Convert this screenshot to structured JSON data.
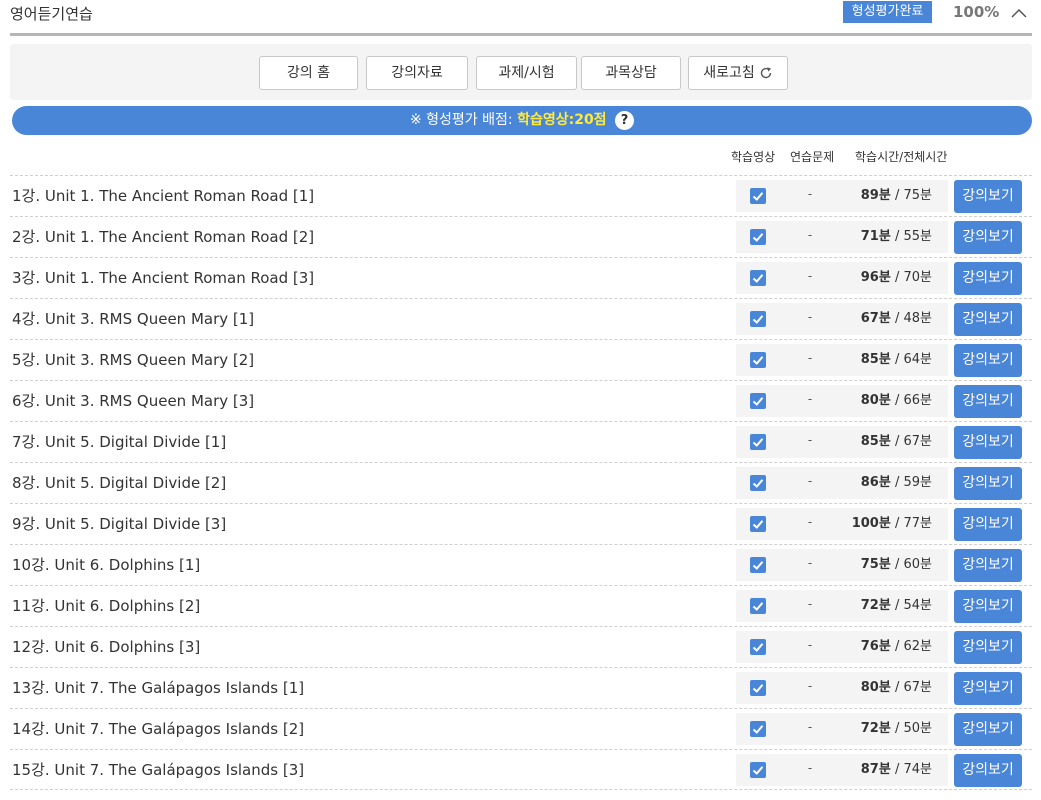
{
  "header": {
    "course_title": "영어듣기연습",
    "badge": "형성평가완료",
    "progress": "100%"
  },
  "toolbar": {
    "home": "강의 홈",
    "materials": "강의자료",
    "assignments": "과제/시험",
    "consult": "과목상담",
    "refresh": "새로고침"
  },
  "notice": {
    "prefix": "※ 형성평가 배점:",
    "highlight": "학습영상:20점",
    "help": "?"
  },
  "columns": {
    "video": "학습영상",
    "practice": "연습문제",
    "time": "학습시간/전체시간"
  },
  "units": {
    "minute": "분",
    "separator": "/"
  },
  "view_label": "강의보기",
  "practice_placeholder": "-",
  "lectures": [
    {
      "title": "1강. Unit 1. The Ancient Roman Road [1]",
      "studied": "89",
      "total": "75",
      "video_done": true
    },
    {
      "title": "2강. Unit 1. The Ancient Roman Road [2]",
      "studied": "71",
      "total": "55",
      "video_done": true
    },
    {
      "title": "3강. Unit 1. The Ancient Roman Road [3]",
      "studied": "96",
      "total": "70",
      "video_done": true
    },
    {
      "title": "4강. Unit 3. RMS Queen Mary [1]",
      "studied": "67",
      "total": "48",
      "video_done": true
    },
    {
      "title": "5강. Unit 3. RMS Queen Mary [2]",
      "studied": "85",
      "total": "64",
      "video_done": true
    },
    {
      "title": "6강. Unit 3. RMS Queen Mary [3]",
      "studied": "80",
      "total": "66",
      "video_done": true
    },
    {
      "title": "7강. Unit 5. Digital Divide [1]",
      "studied": "85",
      "total": "67",
      "video_done": true
    },
    {
      "title": "8강. Unit 5. Digital Divide [2]",
      "studied": "86",
      "total": "59",
      "video_done": true
    },
    {
      "title": "9강. Unit 5. Digital Divide [3]",
      "studied": "100",
      "total": "77",
      "video_done": true
    },
    {
      "title": "10강. Unit 6. Dolphins [1]",
      "studied": "75",
      "total": "60",
      "video_done": true
    },
    {
      "title": "11강. Unit 6. Dolphins [2]",
      "studied": "72",
      "total": "54",
      "video_done": true
    },
    {
      "title": "12강. Unit 6. Dolphins [3]",
      "studied": "76",
      "total": "62",
      "video_done": true
    },
    {
      "title": "13강. Unit 7. The Galápagos Islands [1]",
      "studied": "80",
      "total": "67",
      "video_done": true
    },
    {
      "title": "14강. Unit 7. The Galápagos Islands [2]",
      "studied": "72",
      "total": "50",
      "video_done": true
    },
    {
      "title": "15강. Unit 7. The Galápagos Islands [3]",
      "studied": "87",
      "total": "74",
      "video_done": true
    }
  ],
  "colors": {
    "accent": "#4a86d8",
    "highlight": "#ffeb3b"
  }
}
